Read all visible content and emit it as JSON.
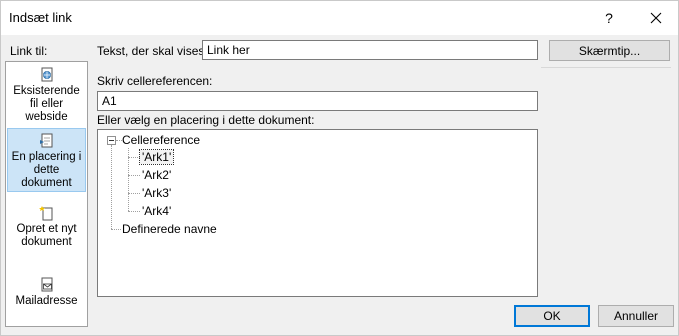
{
  "dialog": {
    "title": "Indsæt link",
    "help": "?"
  },
  "sidebar": {
    "label": "Link til:",
    "items": [
      {
        "lines": [
          "Eksisterende",
          "fil eller",
          "webside"
        ],
        "icon": "web-file-icon"
      },
      {
        "lines": [
          "En placering i",
          "dette",
          "dokument"
        ],
        "icon": "document-place-icon",
        "selected": true
      },
      {
        "lines": [
          "Opret et nyt",
          "dokument"
        ],
        "icon": "new-document-icon"
      },
      {
        "lines": [
          "Mailadresse"
        ],
        "icon": "mail-icon"
      }
    ]
  },
  "text_to_display": {
    "label": "Tekst, der skal vises:",
    "value": "Link her"
  },
  "screentip_button": "Skærmtip...",
  "cell_reference": {
    "label": "Skriv cellereferencen:",
    "value": "A1"
  },
  "place_list": {
    "label": "Eller vælg en placering i dette dokument:",
    "root": "Cellereference",
    "sheets": [
      "'Ark1'",
      "'Ark2'",
      "'Ark3'",
      "'Ark4'"
    ],
    "defined_names": "Definerede navne"
  },
  "footer": {
    "ok": "OK",
    "cancel": "Annuller"
  },
  "colors": {
    "selected_bg": "#cce4f7",
    "default_button_border": "#0078d7"
  }
}
